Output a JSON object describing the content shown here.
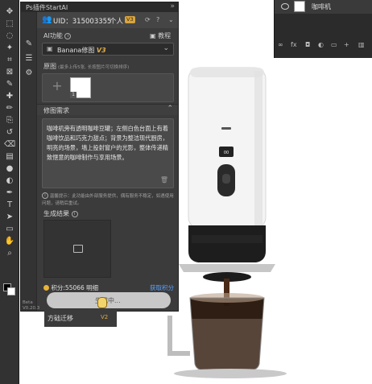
{
  "toolbar": {
    "tools": [
      "move-tool",
      "marquee-tool",
      "lasso-tool",
      "quick-select-tool",
      "crop-tool",
      "frame-tool",
      "eyedropper-tool",
      "healing-tool",
      "brush-tool",
      "stamp-tool",
      "history-brush-tool",
      "eraser-tool",
      "gradient-tool",
      "blur-tool",
      "dodge-tool",
      "pen-tool",
      "type-tool",
      "path-select-tool",
      "rectangle-tool",
      "hand-tool",
      "zoom-tool"
    ]
  },
  "layers": {
    "layer_name": "咖啡机"
  },
  "plugin": {
    "title": "Ps插件StartAI",
    "uid_label": "UID：315003355",
    "role": "个人",
    "role_badge": "V3",
    "ai_function_label": "AI功能",
    "tutorial_label": "教程",
    "model_name": "Banana修图",
    "model_version": "V3",
    "original_label": "原图",
    "original_hint": "(最多上传5张, 长按图片可切换排序)",
    "original_count": "1",
    "requirement_label": "修图需求",
    "requirement_text": "咖啡机旁有透明咖啡豆罐；左侧白色台面上有着咖啡饮品和巧克力甜点；背景为整洁现代厨房，明亮的场景，墙上投射窗户的光影，整体传递精致惬意的咖啡制作与享用场景。",
    "warning_text": "温馨提示：此功能由外部服务提供，偶有服务不稳定，如遇使用问题，请稍后重试。",
    "result_label": "生成结果",
    "points_label": "积分:55066",
    "points_extra": "明细",
    "get_points": "获取积分",
    "generate_button": "生成中...",
    "beta": "Beta\nV0.20.3",
    "history_item": "方础迁移",
    "history_badge": "V2"
  }
}
